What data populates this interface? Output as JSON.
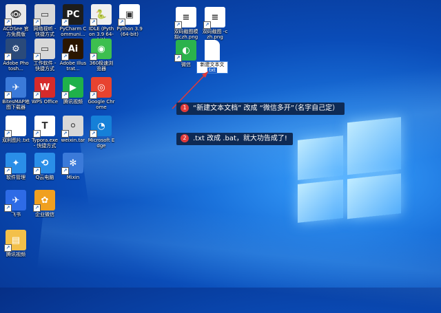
{
  "desktop": {
    "icons": [
      {
        "label": "ACDSee 官方免费版",
        "glyph": "👁",
        "color": "#e8e8e8",
        "icon": "acdsee-icon"
      },
      {
        "label": "网络视听 - 快捷方式",
        "glyph": "▭",
        "color": "#d8d8d8",
        "icon": "drive-icon"
      },
      {
        "label": "PyCharm Communi...",
        "glyph": "PC",
        "color": "#1d1d1d",
        "icon": "pycharm-icon"
      },
      {
        "label": "IDLE (Python 3.9 64-bit)",
        "glyph": "🐍",
        "color": "#f0f0f0",
        "icon": "python-idle-icon"
      },
      {
        "label": "Python 3.9 (64-bit)",
        "glyph": "▣",
        "color": "#ffffff",
        "icon": "python-icon"
      },
      {
        "label": "Adobe Photosh...",
        "glyph": "⚙",
        "color": "#2a4a7a",
        "icon": "photoshop-icon"
      },
      {
        "label": "工作软件 - 快捷方式",
        "glyph": "▭",
        "color": "#d8d8d8",
        "icon": "drive-icon"
      },
      {
        "label": "Adobe Illustrat...",
        "glyph": "Ai",
        "color": "#2b1600",
        "icon": "illustrator-icon"
      },
      {
        "label": "360极速浏览器",
        "glyph": "◉",
        "color": "#3dbf4f",
        "icon": "browser-360-icon"
      },
      {
        "label": "BitesMAP地图下载器",
        "glyph": "✈",
        "color": "#3b7ad9",
        "icon": "map-icon"
      },
      {
        "label": "WPS Office",
        "glyph": "W",
        "color": "#d62a2a",
        "icon": "wps-icon"
      },
      {
        "label": "腾讯视频",
        "glyph": "▶",
        "color": "#1fb14a",
        "icon": "video-icon"
      },
      {
        "label": "Google Chrome",
        "glyph": "◎",
        "color": "#e8432f",
        "icon": "chrome-icon"
      },
      {
        "label": "双利图片.txt",
        "glyph": "",
        "color": "#ffffff",
        "icon": "text-file-icon"
      },
      {
        "label": "Typora.exe - 快捷方式",
        "glyph": "T",
        "color": "#ffffff",
        "icon": "typora-icon"
      },
      {
        "label": "weixin.tar",
        "glyph": "⚪",
        "color": "#d8d8d8",
        "icon": "archive-icon"
      },
      {
        "label": "Microsoft Edge",
        "glyph": "◔",
        "color": "#1580d8",
        "icon": "edge-icon"
      },
      {
        "label": "软件管理",
        "glyph": "✦",
        "color": "#2a8ee8",
        "icon": "software-manager-icon"
      },
      {
        "label": "Q云电脑",
        "glyph": "⟲",
        "color": "#2a8ee8",
        "icon": "cloud-pc-icon"
      },
      {
        "label": "Mixin",
        "glyph": "✻",
        "color": "#3b7ad9",
        "icon": "mixin-icon"
      },
      {
        "label": "飞书",
        "glyph": "✈",
        "color": "#2e6be6",
        "icon": "feishu-icon"
      },
      {
        "label": "企业微信",
        "glyph": "✿",
        "color": "#f0a020",
        "icon": "wecom-icon"
      },
      {
        "label": "腾讯视频",
        "glyph": "▤",
        "color": "#f3c04a",
        "icon": "folder-icon"
      },
      {
        "label": "双码截图模拟czh.png",
        "glyph": "≡",
        "color": "#ffffff",
        "icon": "image-file-icon"
      },
      {
        "label": "双码截图 -czh.png",
        "glyph": "≡",
        "color": "#ffffff",
        "icon": "image-file-icon"
      },
      {
        "label": "微信",
        "glyph": "◐",
        "color": "#2bb24c",
        "icon": "wechat-icon"
      }
    ],
    "selected_file": {
      "name": "新建文本文",
      "ext": "txt"
    }
  },
  "callouts": [
    {
      "num": "1",
      "text": "“新建文本文档” 改成 “微信多开”（名字自己定）"
    },
    {
      "num": "2",
      "text": ".txt 改成 .bat，就大功告成了!"
    }
  ],
  "colors": {
    "callout_bg": "#0e2a55",
    "badge": "#e03a3a",
    "arrow": "#e03a3a"
  }
}
